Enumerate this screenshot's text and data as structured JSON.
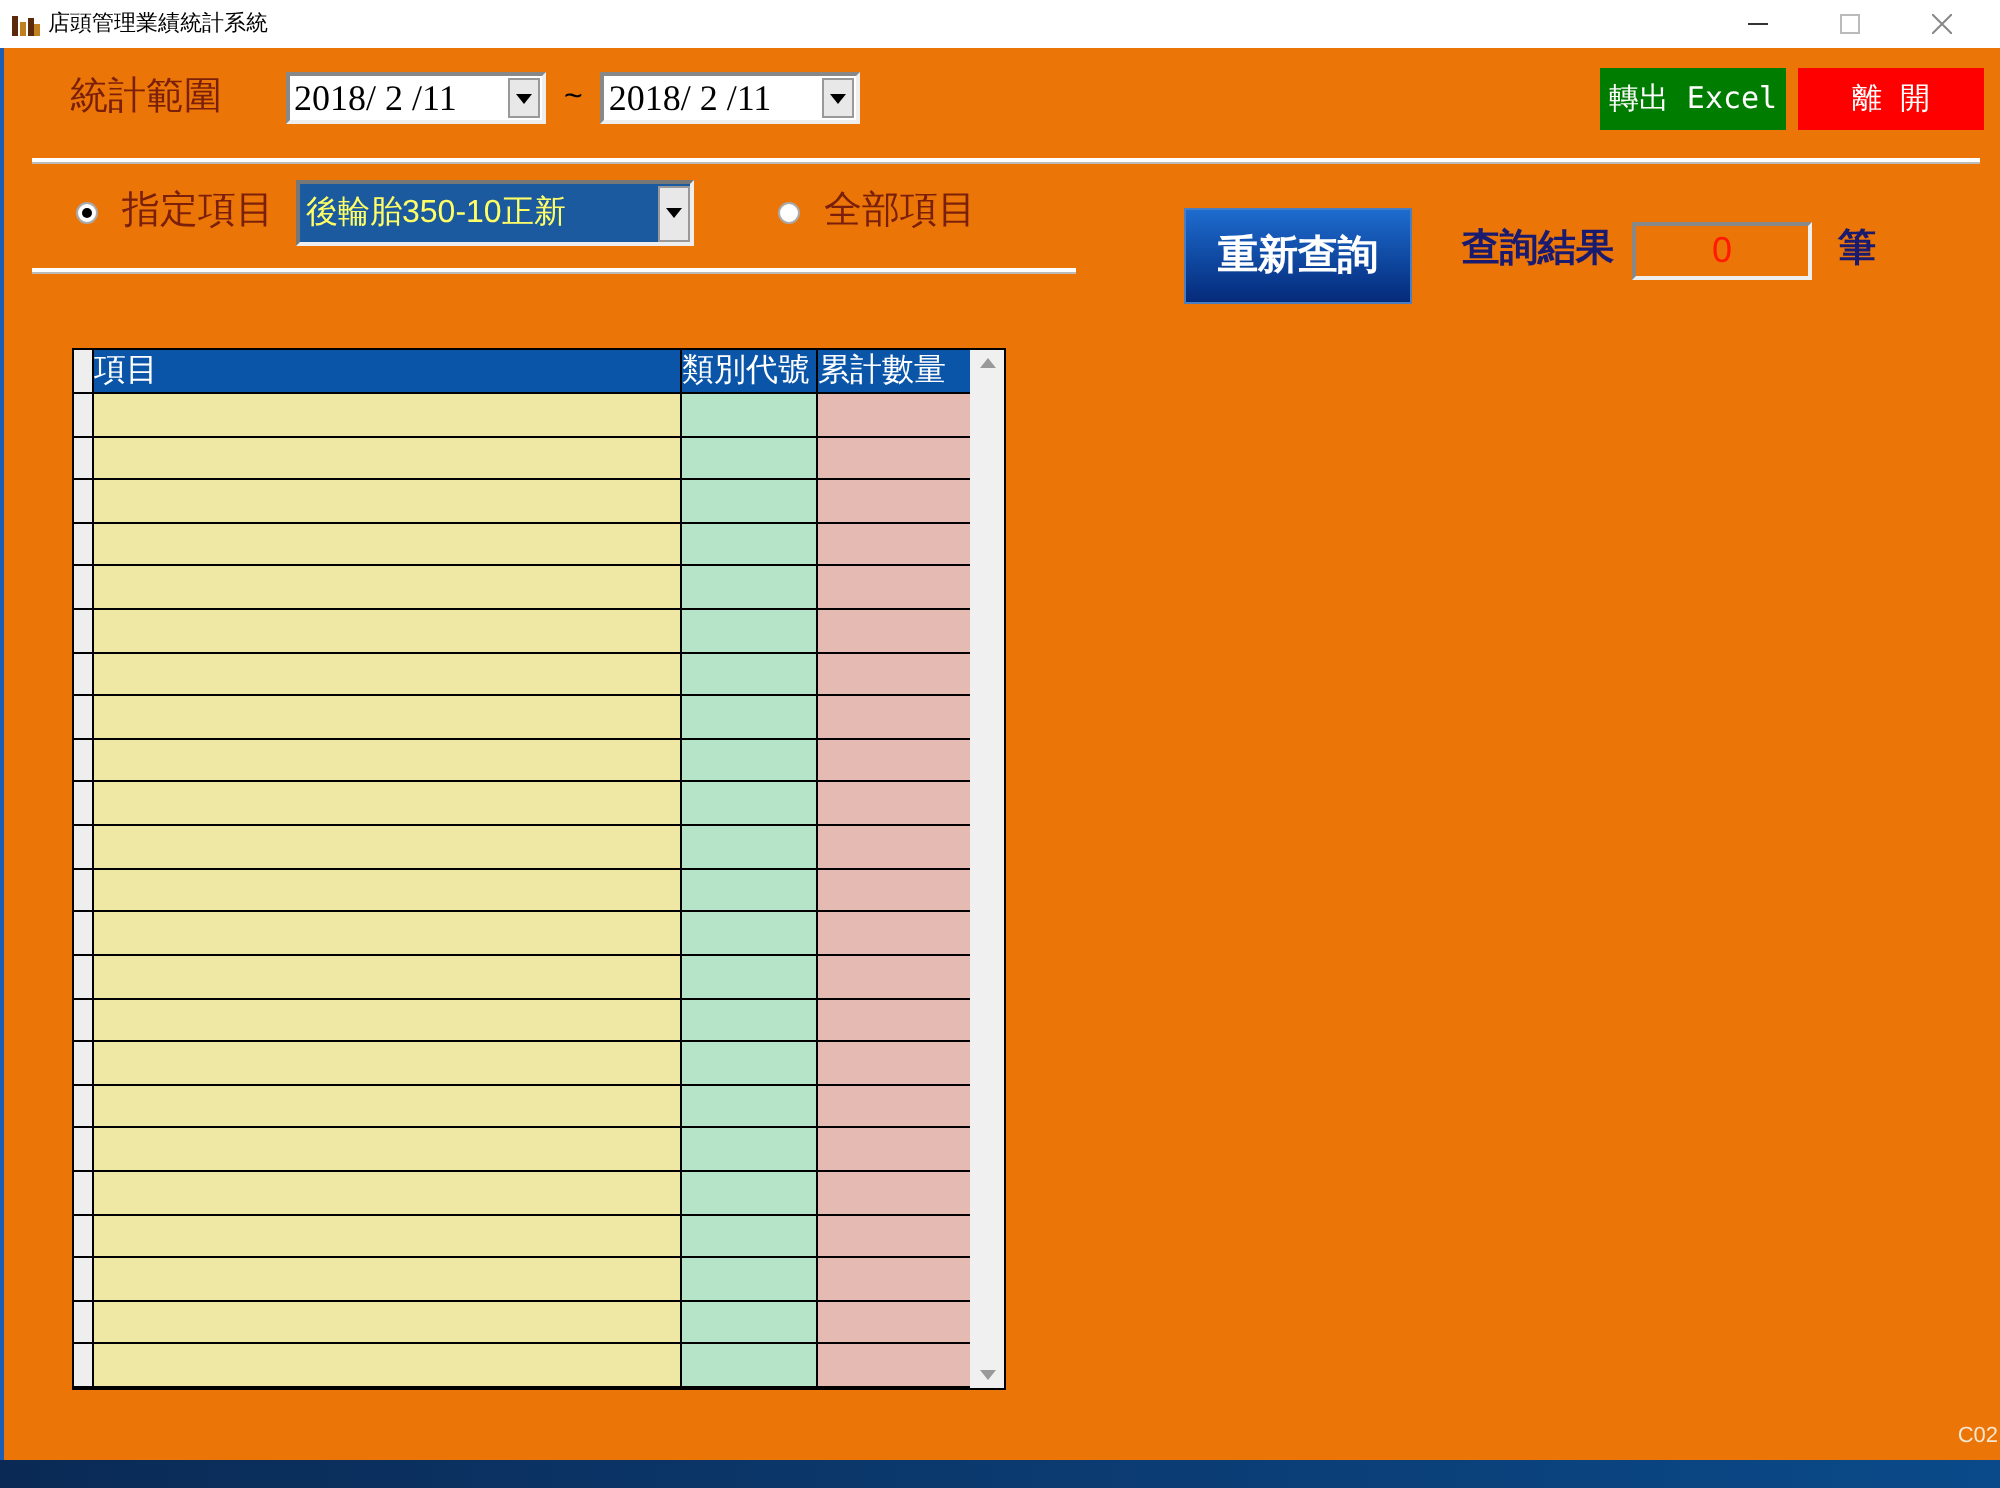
{
  "window": {
    "title": "店頭管理業績統計系統"
  },
  "range": {
    "label": "統計範圍",
    "from": "2018/ 2 /11",
    "separator": "~",
    "to": "2018/ 2 /11"
  },
  "buttons": [
    {
      "label": "轉出 Excel",
      "kind": "export"
    },
    {
      "label": "離 開",
      "kind": "exit"
    }
  ],
  "options": [
    {
      "label": "指定項目",
      "selected": true
    },
    {
      "label": "全部項目",
      "selected": false
    }
  ],
  "item_select": {
    "value": "後輪胎350-10正新"
  },
  "query_button": {
    "label": "重新查詢"
  },
  "result": {
    "label": "查詢結果",
    "value": "0",
    "unit": "筆"
  },
  "table": {
    "columns": [
      "項目",
      "類別代號",
      "累計數量"
    ]
  },
  "footer_code": "C02"
}
